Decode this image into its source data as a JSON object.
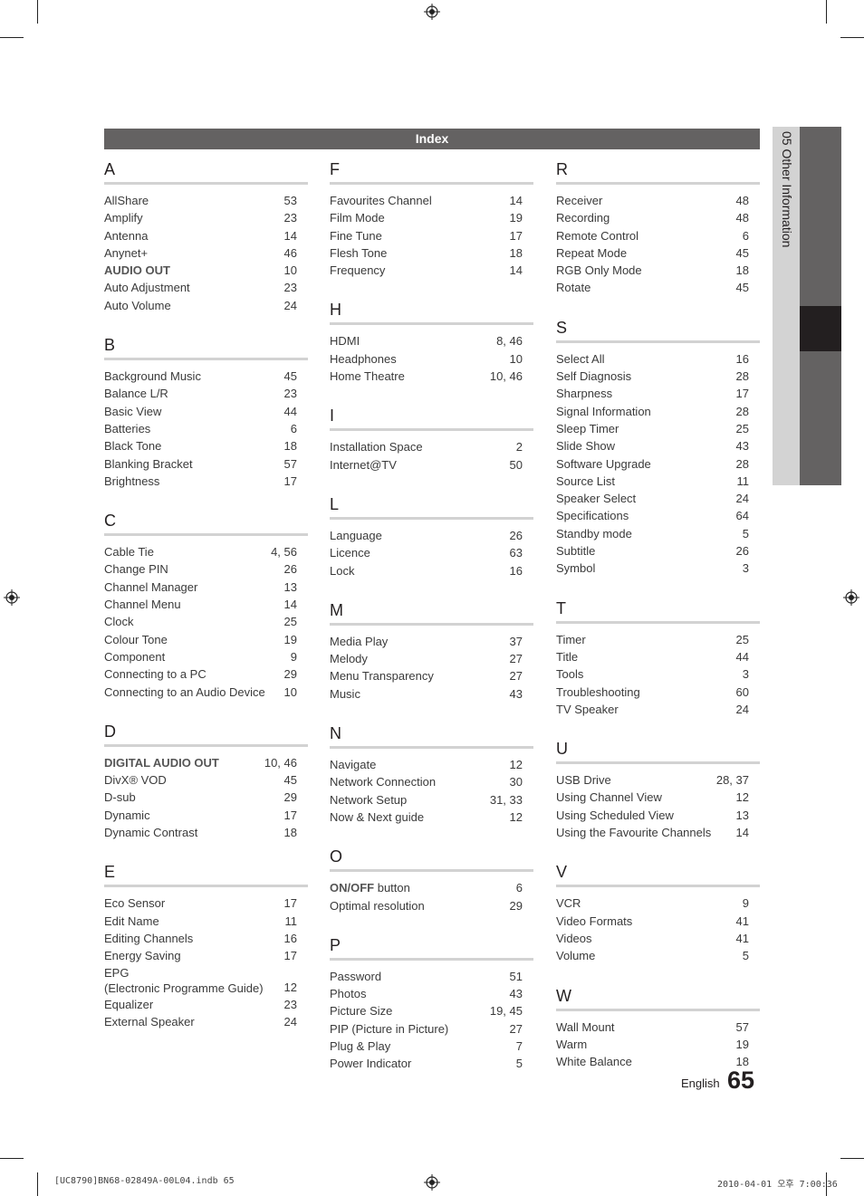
{
  "header": {
    "title": "Index"
  },
  "side_tab": {
    "label": "05   Other Information"
  },
  "columns": [
    [
      {
        "letter": "A",
        "entries": [
          {
            "term": "AllShare",
            "page": "53"
          },
          {
            "term": "Amplify",
            "page": "23"
          },
          {
            "term": "Antenna",
            "page": "14"
          },
          {
            "term": "Anynet+",
            "page": "46"
          },
          {
            "term": "AUDIO OUT",
            "page": "10",
            "bold": true
          },
          {
            "term": "Auto Adjustment",
            "page": "23"
          },
          {
            "term": "Auto Volume",
            "page": "24"
          }
        ]
      },
      {
        "letter": "B",
        "entries": [
          {
            "term": "Background Music",
            "page": "45"
          },
          {
            "term": "Balance L/R",
            "page": "23"
          },
          {
            "term": "Basic View",
            "page": "44"
          },
          {
            "term": "Batteries",
            "page": "6"
          },
          {
            "term": "Black Tone",
            "page": "18"
          },
          {
            "term": "Blanking Bracket",
            "page": "57"
          },
          {
            "term": "Brightness",
            "page": "17"
          }
        ]
      },
      {
        "letter": "C",
        "entries": [
          {
            "term": "Cable Tie",
            "page": "4, 56"
          },
          {
            "term": "Change PIN",
            "page": "26"
          },
          {
            "term": "Channel Manager",
            "page": "13"
          },
          {
            "term": "Channel Menu",
            "page": "14"
          },
          {
            "term": "Clock",
            "page": "25"
          },
          {
            "term": "Colour Tone",
            "page": "19"
          },
          {
            "term": "Component",
            "page": "9"
          },
          {
            "term": "Connecting to a PC",
            "page": "29"
          },
          {
            "term": "Connecting to an Audio Device",
            "page": "10"
          }
        ]
      },
      {
        "letter": "D",
        "entries": [
          {
            "term": "DIGITAL AUDIO OUT",
            "page": "10, 46",
            "bold": true
          },
          {
            "term": "DivX® VOD",
            "page": "45"
          },
          {
            "term": "D-sub",
            "page": "29"
          },
          {
            "term": "Dynamic",
            "page": "17"
          },
          {
            "term": "Dynamic Contrast",
            "page": "18"
          }
        ]
      },
      {
        "letter": "E",
        "entries": [
          {
            "term": "Eco Sensor",
            "page": "17"
          },
          {
            "term": "Edit Name",
            "page": "11"
          },
          {
            "term": "Editing Channels",
            "page": "16"
          },
          {
            "term": "Energy Saving",
            "page": "17"
          },
          {
            "term": "EPG\n(Electronic Programme Guide)",
            "page": "12"
          },
          {
            "term": "Equalizer",
            "page": "23"
          },
          {
            "term": "External Speaker",
            "page": "24"
          }
        ]
      }
    ],
    [
      {
        "letter": "F",
        "entries": [
          {
            "term": "Favourites Channel",
            "page": "14"
          },
          {
            "term": "Film Mode",
            "page": "19"
          },
          {
            "term": "Fine Tune",
            "page": "17"
          },
          {
            "term": "Flesh Tone",
            "page": "18"
          },
          {
            "term": "Frequency",
            "page": "14"
          }
        ]
      },
      {
        "letter": "H",
        "entries": [
          {
            "term": "HDMI",
            "page": "8, 46"
          },
          {
            "term": "Headphones",
            "page": "10"
          },
          {
            "term": "Home Theatre",
            "page": "10, 46"
          }
        ]
      },
      {
        "letter": "I",
        "entries": [
          {
            "term": "Installation Space",
            "page": "2"
          },
          {
            "term": "Internet@TV",
            "page": "50"
          }
        ]
      },
      {
        "letter": "L",
        "entries": [
          {
            "term": "Language",
            "page": "26"
          },
          {
            "term": "Licence",
            "page": "63"
          },
          {
            "term": "Lock",
            "page": "16"
          }
        ]
      },
      {
        "letter": "M",
        "entries": [
          {
            "term": "Media Play",
            "page": "37"
          },
          {
            "term": "Melody",
            "page": "27"
          },
          {
            "term": "Menu Transparency",
            "page": "27"
          },
          {
            "term": "Music",
            "page": "43"
          }
        ]
      },
      {
        "letter": "N",
        "entries": [
          {
            "term": "Navigate",
            "page": "12"
          },
          {
            "term": "Network Connection",
            "page": "30"
          },
          {
            "term": "Network Setup",
            "page": "31, 33"
          },
          {
            "term": "Now & Next guide",
            "page": "12"
          }
        ]
      },
      {
        "letter": "O",
        "entries": [
          {
            "term": "ON/OFF",
            "suffix": " button",
            "page": "6",
            "bold": true
          },
          {
            "term": "Optimal resolution",
            "page": "29"
          }
        ]
      },
      {
        "letter": "P",
        "entries": [
          {
            "term": "Password",
            "page": "51"
          },
          {
            "term": "Photos",
            "page": "43"
          },
          {
            "term": "Picture Size",
            "page": "19, 45"
          },
          {
            "term": "PIP (Picture in Picture)",
            "page": "27"
          },
          {
            "term": "Plug & Play",
            "page": "7"
          },
          {
            "term": "Power Indicator",
            "page": "5"
          }
        ]
      }
    ],
    [
      {
        "letter": "R",
        "entries": [
          {
            "term": "Receiver",
            "page": "48"
          },
          {
            "term": "Recording",
            "page": "48"
          },
          {
            "term": "Remote Control",
            "page": "6"
          },
          {
            "term": "Repeat Mode",
            "page": "45"
          },
          {
            "term": "RGB Only Mode",
            "page": "18"
          },
          {
            "term": "Rotate",
            "page": "45"
          }
        ]
      },
      {
        "letter": "S",
        "entries": [
          {
            "term": "Select All",
            "page": "16"
          },
          {
            "term": "Self Diagnosis",
            "page": "28"
          },
          {
            "term": "Sharpness",
            "page": "17"
          },
          {
            "term": "Signal Information",
            "page": "28"
          },
          {
            "term": "Sleep Timer",
            "page": "25"
          },
          {
            "term": "Slide Show",
            "page": "43"
          },
          {
            "term": "Software Upgrade",
            "page": "28"
          },
          {
            "term": "Source List",
            "page": "11"
          },
          {
            "term": "Speaker Select",
            "page": "24"
          },
          {
            "term": "Specifications",
            "page": "64"
          },
          {
            "term": "Standby mode",
            "page": "5"
          },
          {
            "term": "Subtitle",
            "page": "26"
          },
          {
            "term": "Symbol",
            "page": "3"
          }
        ]
      },
      {
        "letter": "T",
        "entries": [
          {
            "term": "Timer",
            "page": "25"
          },
          {
            "term": "Title",
            "page": "44"
          },
          {
            "term": "Tools",
            "page": "3"
          },
          {
            "term": "Troubleshooting",
            "page": "60"
          },
          {
            "term": "TV Speaker",
            "page": "24"
          }
        ]
      },
      {
        "letter": "U",
        "entries": [
          {
            "term": "USB Drive",
            "page": "28, 37"
          },
          {
            "term": "Using Channel View",
            "page": "12"
          },
          {
            "term": "Using Scheduled View",
            "page": "13"
          },
          {
            "term": "Using the Favourite Channels",
            "page": "14"
          }
        ]
      },
      {
        "letter": "V",
        "entries": [
          {
            "term": "VCR",
            "page": "9"
          },
          {
            "term": "Video Formats",
            "page": "41"
          },
          {
            "term": "Videos",
            "page": "41"
          },
          {
            "term": "Volume",
            "page": "5"
          }
        ]
      },
      {
        "letter": "W",
        "entries": [
          {
            "term": "Wall Mount",
            "page": "57"
          },
          {
            "term": "Warm",
            "page": "19"
          },
          {
            "term": "White Balance",
            "page": "18"
          }
        ]
      }
    ]
  ],
  "footer": {
    "language": "English",
    "page_number": "65"
  },
  "print_slug": {
    "left": "[UC8790]BN68-02849A-00L04.indb   65",
    "right": "2010-04-01   오후 7:00:36"
  },
  "icons": {
    "registration_mark": "crosshair-target"
  }
}
